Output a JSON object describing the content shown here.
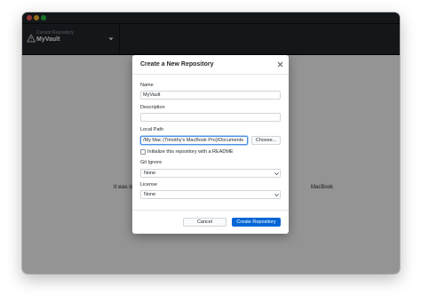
{
  "toolbar": {
    "current_repository_label": "Current Repository",
    "repository_name": "MyVault"
  },
  "background": {
    "text_left": "It was la",
    "text_right": "MacBook"
  },
  "dialog": {
    "title": "Create a New Repository",
    "name_label": "Name",
    "name_value": "MyVault",
    "description_label": "Description",
    "description_value": "",
    "local_path_label": "Local Path",
    "local_path_value": "/My Mac (Timothy's MacBook Pro)/Documents",
    "choose_button": "Choose...",
    "readme_label": "Initialize this repository with a README",
    "readme_checked": false,
    "gitignore_label": "Git Ignore",
    "gitignore_value": "None",
    "license_label": "License",
    "license_value": "None",
    "cancel_button": "Cancel",
    "create_button": "Create Repository"
  },
  "colors": {
    "toolbar": "#24292e",
    "primary_button": "#0366d6",
    "overlay": "rgba(0,0,0,0.42)"
  },
  "icons": {
    "repo_warning": "warning-triangle-icon",
    "repo_dropdown": "chevron-down-icon",
    "close": "close-icon",
    "select_dropdown": "chevron-down-icon"
  }
}
